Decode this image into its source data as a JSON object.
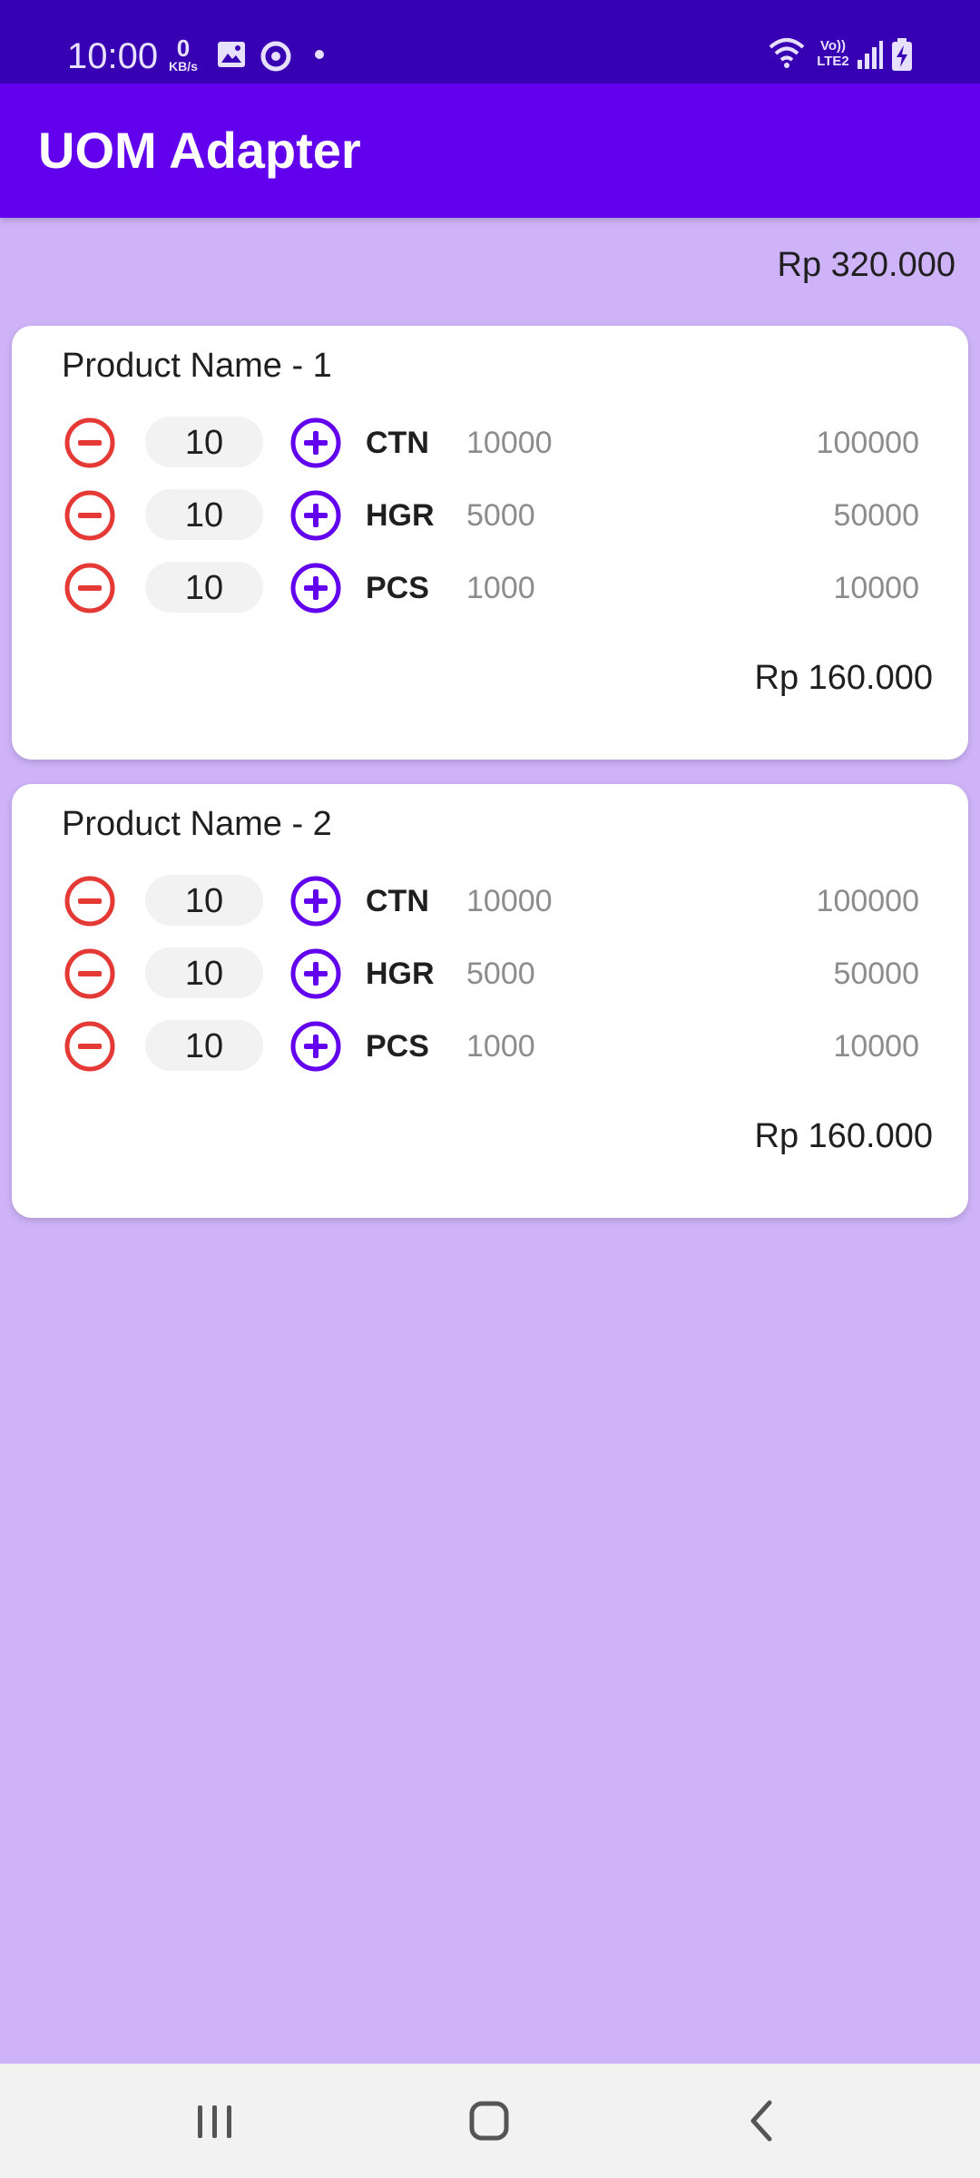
{
  "status_bar": {
    "time": "10:00",
    "speed_value": "0",
    "speed_unit": "KB/s",
    "icons": [
      "image-icon",
      "sync-icon",
      "dot-icon",
      "wifi-icon",
      "volte-icon",
      "signal-icon",
      "battery-charging-icon"
    ],
    "volte_label": "Vo))",
    "lte_label": "LTE2"
  },
  "app_bar": {
    "title": "UOM Adapter"
  },
  "grand_total": "Rp 320.000",
  "colors": {
    "status_bar": "#3700b3",
    "app_bar": "#6200ee",
    "background": "#cfb3f9",
    "minus_icon": "#e53935",
    "plus_icon": "#6200ee"
  },
  "products": [
    {
      "name": "Product Name - 1",
      "total": "Rp 160.000",
      "uoms": [
        {
          "qty": "10",
          "unit": "CTN",
          "price": "10000",
          "subtotal": "100000"
        },
        {
          "qty": "10",
          "unit": "HGR",
          "price": "5000",
          "subtotal": "50000"
        },
        {
          "qty": "10",
          "unit": "PCS",
          "price": "1000",
          "subtotal": "10000"
        }
      ]
    },
    {
      "name": "Product Name - 2",
      "total": "Rp 160.000",
      "uoms": [
        {
          "qty": "10",
          "unit": "CTN",
          "price": "10000",
          "subtotal": "100000"
        },
        {
          "qty": "10",
          "unit": "HGR",
          "price": "5000",
          "subtotal": "50000"
        },
        {
          "qty": "10",
          "unit": "PCS",
          "price": "1000",
          "subtotal": "10000"
        }
      ]
    }
  ],
  "nav_bar": {
    "buttons": [
      "recent-apps-icon",
      "home-icon",
      "back-icon"
    ]
  }
}
